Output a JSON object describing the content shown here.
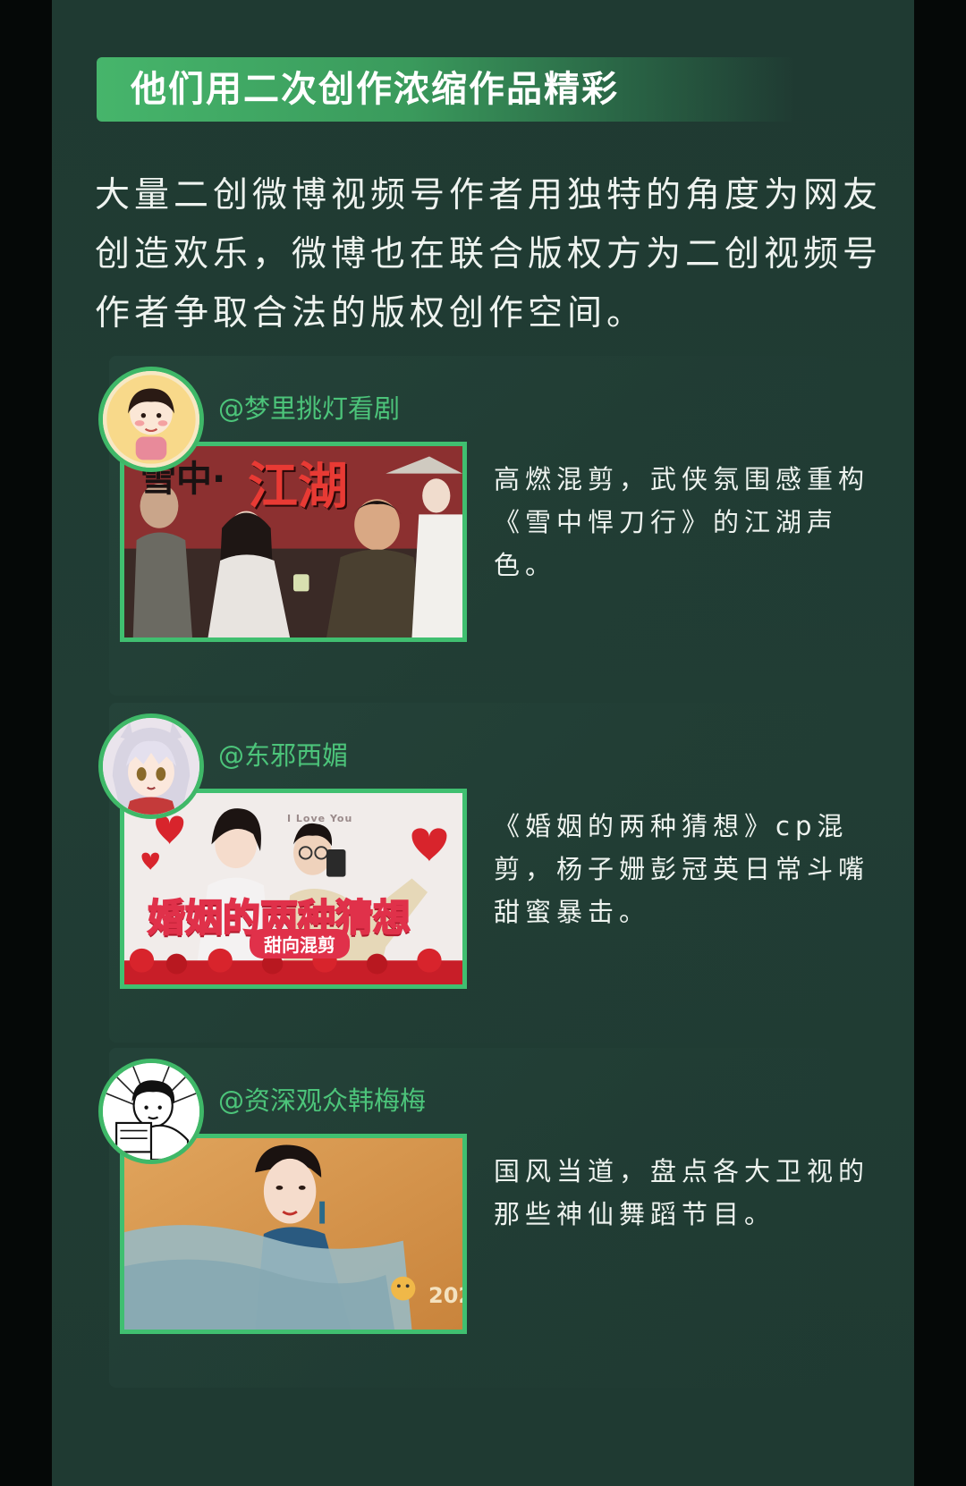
{
  "header": {
    "title": "他们用二次创作浓缩作品精彩"
  },
  "intro": {
    "text": "大量二创微博视频号作者用独特的角度为网友创造欢乐，微博也在联合版权方为二创视频号作者争取合法的版权创作空间。"
  },
  "cards": [
    {
      "handle": "@梦里挑灯看剧",
      "description": "高燃混剪，武侠氛围感重构《雪中悍刀行》的江湖声色。",
      "thumb_text": "江湖",
      "thumb_prefix": "雪中·"
    },
    {
      "handle": "@东邪西媚",
      "description": "《婚姻的两种猜想》cp混剪，杨子姗彭冠英日常斗嘴甜蜜暴击。",
      "thumb_text": "婚姻的两种猜想",
      "thumb_subtext": "甜向混剪",
      "thumb_bg_words": "I Love You"
    },
    {
      "handle": "@资深观众韩梅梅",
      "description": "国风当道，盘点各大卫视的那些神仙舞蹈节目。",
      "thumb_watermark": "202"
    }
  ],
  "colors": {
    "accent_green": "#40bf70",
    "handle_green": "#4cc47a",
    "panel_bg": "#213d34"
  }
}
